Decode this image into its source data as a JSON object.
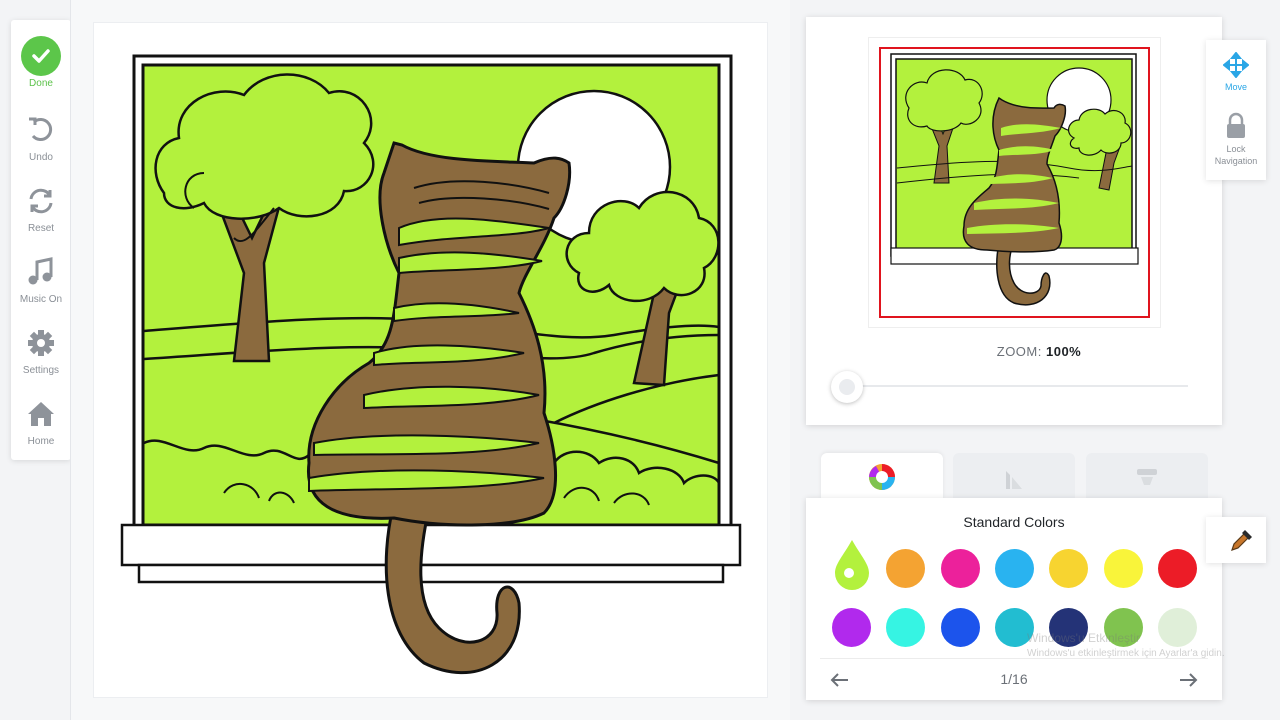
{
  "sidebar": {
    "items": [
      {
        "label": "Done",
        "icon": "check-icon"
      },
      {
        "label": "Undo",
        "icon": "undo-icon"
      },
      {
        "label": "Reset",
        "icon": "reset-icon"
      },
      {
        "label": "Music On",
        "icon": "music-note-icon"
      },
      {
        "label": "Settings",
        "icon": "gear-icon"
      },
      {
        "label": "Home",
        "icon": "home-icon"
      }
    ]
  },
  "preview": {
    "zoom_label": "ZOOM:",
    "zoom_value": "100%"
  },
  "navigation": {
    "move_label": "Move",
    "lock_label": "Lock Navigation"
  },
  "palette": {
    "tabs": [
      {
        "icon": "color-wheel-icon",
        "active": true
      },
      {
        "icon": "gradient-icon",
        "active": false
      },
      {
        "icon": "pattern-icon",
        "active": false
      }
    ],
    "title": "Standard Colors",
    "selected_color": "#b3f13d",
    "colors_row1": [
      "#f4a332",
      "#ec219b",
      "#29b3f0",
      "#f7d430",
      "#f9f43a",
      "#ec1c27"
    ],
    "colors_row2": [
      "#b129ed",
      "#36f4e3",
      "#1c54ec",
      "#22bdd1",
      "#243377",
      "#80c34f",
      "#e0efd9"
    ],
    "page_indicator": "1/16"
  },
  "artwork": {
    "subject": "cat looking out window",
    "fill_green": "#b3f13d",
    "cat_brown": "#8b6a3e"
  },
  "watermark": {
    "line1": "Windows'u Etkinleştir",
    "line2": "Windows'u etkinleştirmek için Ayarlar'a gidin."
  }
}
